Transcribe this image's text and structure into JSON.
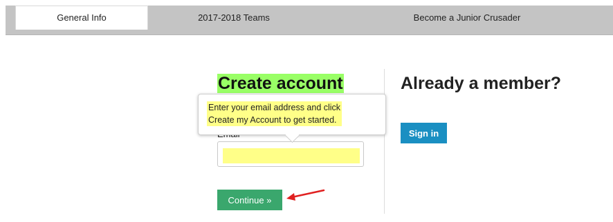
{
  "tabs": [
    {
      "label": "General Info",
      "active": true
    },
    {
      "label": "2017-2018 Teams",
      "active": false
    },
    {
      "label": "Become a Junior Crusader",
      "active": false
    }
  ],
  "create": {
    "title": "Create account",
    "email_label": "Email",
    "email_value": "",
    "continue_label": "Continue »"
  },
  "tooltip": {
    "text": "Enter your email address and click\nCreate my Account to get started."
  },
  "member": {
    "title": "Already a member?",
    "signin_label": "Sign in"
  },
  "colors": {
    "highlight_green": "#99ff66",
    "highlight_yellow": "#ffff88",
    "continue_green": "#3aa76d",
    "signin_blue": "#1a8fc2",
    "annotation_red": "#e02020"
  }
}
